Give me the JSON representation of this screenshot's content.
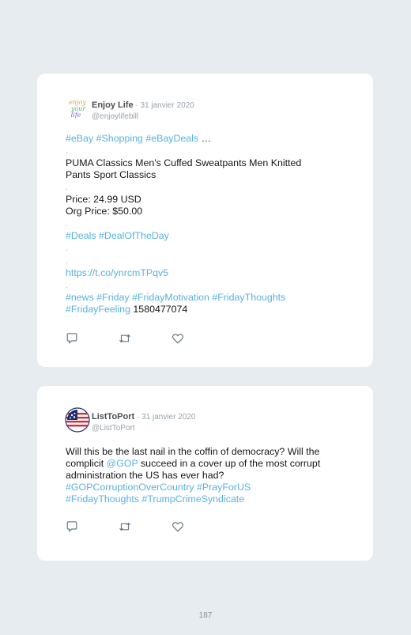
{
  "tweets": [
    {
      "name": "Enjoy Life",
      "date": " · 31 janvier 2020",
      "handle": "@enjoylifebill",
      "avatar_text": [
        "enjoy",
        "your",
        "life"
      ],
      "lines": [
        [
          {
            "t": "#eBay",
            "tag": true
          },
          {
            "t": " ",
            "tag": false
          },
          {
            "t": "#Shopping",
            "tag": true
          },
          {
            "t": " ",
            "tag": false
          },
          {
            "t": "#eBayDeals",
            "tag": true
          },
          {
            "t": " …",
            "tag": false
          }
        ],
        [
          {
            "t": ".",
            "tag": false,
            "dot": true
          }
        ],
        [
          {
            "t": "PUMA Classics Men's Cuffed Sweatpants Men Knitted",
            "tag": false
          }
        ],
        [
          {
            "t": "Pants Sport Classics",
            "tag": false
          }
        ],
        [
          {
            "t": ".",
            "tag": false,
            "dot": true
          }
        ],
        [
          {
            "t": "Price: 24.99 USD",
            "tag": false
          }
        ],
        [
          {
            "t": "Org Price: $50.00",
            "tag": false
          }
        ],
        [
          {
            "t": ".",
            "tag": false,
            "dot": true
          }
        ],
        [
          {
            "t": "#Deals",
            "tag": true
          },
          {
            "t": " ",
            "tag": false
          },
          {
            "t": "#DealOfTheDay",
            "tag": true
          }
        ],
        [
          {
            "t": ".",
            "tag": false,
            "dot": true
          }
        ],
        [
          {
            "t": ".",
            "tag": false,
            "dot": true
          }
        ],
        [
          {
            "t": "https://t.co/ynrcmTPqv5",
            "tag": true
          }
        ],
        [
          {
            "t": ".",
            "tag": false,
            "dot": true
          }
        ],
        [
          {
            "t": "#news",
            "tag": true
          },
          {
            "t": " ",
            "tag": false
          },
          {
            "t": "#Friday",
            "tag": true
          },
          {
            "t": " ",
            "tag": false
          },
          {
            "t": "#FridayMotivation",
            "tag": true
          },
          {
            "t": " ",
            "tag": false
          },
          {
            "t": "#FridayThoughts",
            "tag": true
          }
        ],
        [
          {
            "t": "#FridayFeeling",
            "tag": true
          },
          {
            "t": " 1580477074",
            "tag": false
          }
        ]
      ]
    },
    {
      "name": "ListToPort",
      "date": " · 31 janvier 2020",
      "handle": "@ListToPort",
      "lines": [
        [
          {
            "t": "Will this be the last nail in the coffin of democracy? Will the",
            "tag": false
          }
        ],
        [
          {
            "t": "complicit ",
            "tag": false
          },
          {
            "t": "@GOP",
            "tag": true
          },
          {
            "t": " succeed in a cover up of the most corrupt",
            "tag": false
          }
        ],
        [
          {
            "t": "administration the US has ever had?",
            "tag": false
          }
        ],
        [
          {
            "t": "#GOPCorruptionOverCountry",
            "tag": true
          },
          {
            "t": " ",
            "tag": false
          },
          {
            "t": "#PrayForUS",
            "tag": true
          }
        ],
        [
          {
            "t": "#FridayThoughts",
            "tag": true
          },
          {
            "t": " ",
            "tag": false
          },
          {
            "t": "#TrumpCrimeSyndicate",
            "tag": true
          }
        ]
      ]
    }
  ],
  "icons": {
    "reply": "speech-bubble-icon",
    "retweet": "retweet-arrows-icon",
    "like": "heart-icon"
  },
  "colors": {
    "background": "#e6ecf0",
    "card": "#ffffff",
    "link": "#58b2e0",
    "icon": "#657786"
  },
  "page_number": "187"
}
